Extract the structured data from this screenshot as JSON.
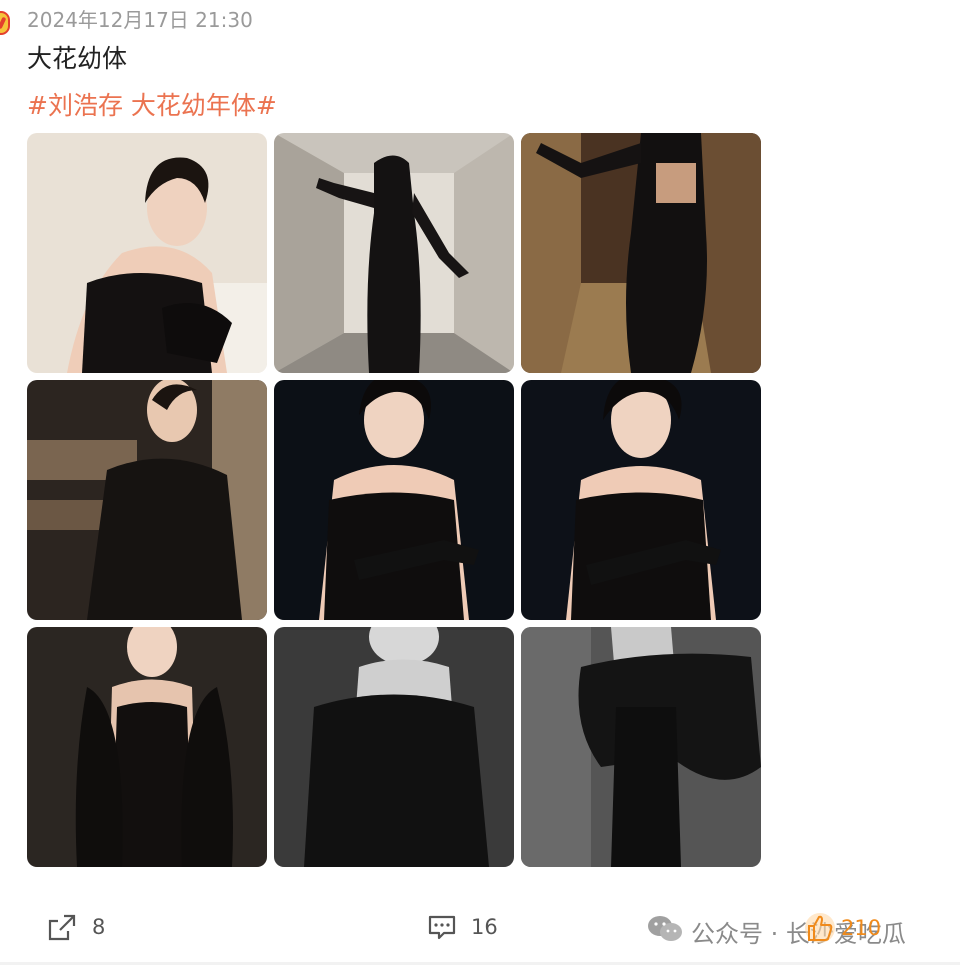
{
  "post": {
    "timestamp": "2024年12月17日 21:30",
    "text": "大花幼体",
    "topic": "#刘浩存 大花幼年体#"
  },
  "photos": [
    {
      "icon": "portrait-photo"
    },
    {
      "icon": "hallway-photo"
    },
    {
      "icon": "dress-back-photo"
    },
    {
      "icon": "fur-coat-photo"
    },
    {
      "icon": "portrait-photo"
    },
    {
      "icon": "portrait-photo"
    },
    {
      "icon": "fur-coat-photo"
    },
    {
      "icon": "fur-coat-photo"
    },
    {
      "icon": "fur-coat-photo"
    }
  ],
  "actions": {
    "repost_count": "8",
    "comment_count": "16",
    "like_count": "210"
  },
  "watermark": {
    "text": "公众号 · 长沙爱吃瓜"
  },
  "colors": {
    "topic": "#eb7350",
    "like": "#f08a1a",
    "timestamp": "#9a9a9a"
  }
}
